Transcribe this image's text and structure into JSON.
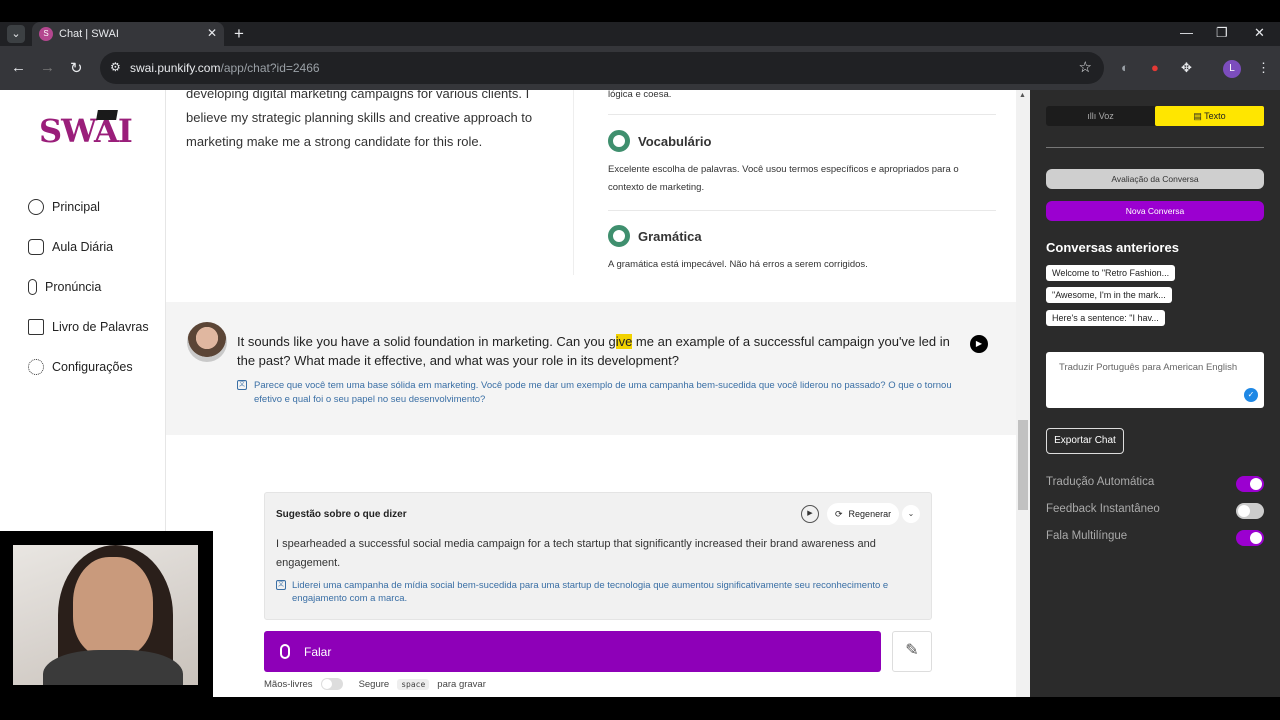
{
  "browser": {
    "tab_title": "Chat | SWAI",
    "url_host": "swai.punkify.com",
    "url_path": "/app/chat?id=2466",
    "profile_initial": "L"
  },
  "sidebar": {
    "logo": "SWAI",
    "items": [
      {
        "label": "Principal",
        "icon": "home-icon"
      },
      {
        "label": "Aula Diária",
        "icon": "chat-bubbles-icon"
      },
      {
        "label": "Pronúncia",
        "icon": "microphone-icon"
      },
      {
        "label": "Livro de Palavras",
        "icon": "book-icon"
      },
      {
        "label": "Configurações",
        "icon": "gear-icon"
      }
    ]
  },
  "prev_message": {
    "text": "developing digital marketing campaigns for various clients. I believe my strategic planning skills and creative approach to marketing make me a strong candidate for this role."
  },
  "feedback": {
    "top_text": "lógica e coesa.",
    "vocab_title": "Vocabulário",
    "vocab_text": "Excelente escolha de palavras. Você usou termos específicos e apropriados para o contexto de marketing.",
    "grammar_title": "Gramática",
    "grammar_text": "A gramática está impecável. Não há erros a serem corrigidos."
  },
  "ai_message": {
    "text_before": "It sounds like you have a solid foundation in marketing. Can you g",
    "text_highlight": "ive",
    "text_after": " me an example of a successful campaign you've led in the past? What made it effective, and what was your role in its development?",
    "translation": "Parece que você tem uma base sólida em marketing. Você pode me dar um exemplo de uma campanha bem-sucedida que você liderou no passado? O que o tornou efetivo e qual foi o seu papel no seu desenvolvimento?"
  },
  "suggestion": {
    "title": "Sugestão sobre o que dizer",
    "regen_label": "Regenerar",
    "text": "I spearheaded a successful social media campaign for a tech startup that significantly increased their brand awareness and engagement.",
    "translation": "Liderei uma campanha de mídia social bem-sucedida para uma startup de tecnologia que aumentou significativamente seu reconhecimento e engajamento com a marca."
  },
  "controls": {
    "speak_label": "Falar",
    "handsfree_label": "Mãos-livres",
    "hold_prefix": "Segure",
    "hold_key": "space",
    "hold_suffix": "para gravar"
  },
  "right_panel": {
    "mode_voice": "Voz",
    "mode_text": "Texto",
    "eval_button": "Avaliação da Conversa",
    "new_button": "Nova Conversa",
    "history_title": "Conversas anteriores",
    "history": [
      "Welcome to \"Retro Fashion...",
      "\"Awesome, I'm in the mark...",
      "Here's a sentence: \"I hav..."
    ],
    "translate_placeholder": "Traduzir Português para American English",
    "export_button": "Exportar Chat",
    "settings": [
      {
        "label": "Tradução Automática",
        "on": true
      },
      {
        "label": "Feedback Instantâneo",
        "on": false
      },
      {
        "label": "Fala Multilíngue",
        "on": true
      }
    ]
  },
  "colors": {
    "accent_purple": "#8e00b8",
    "highlight_yellow": "#ffe600",
    "feedback_green": "#3f8f6e"
  }
}
